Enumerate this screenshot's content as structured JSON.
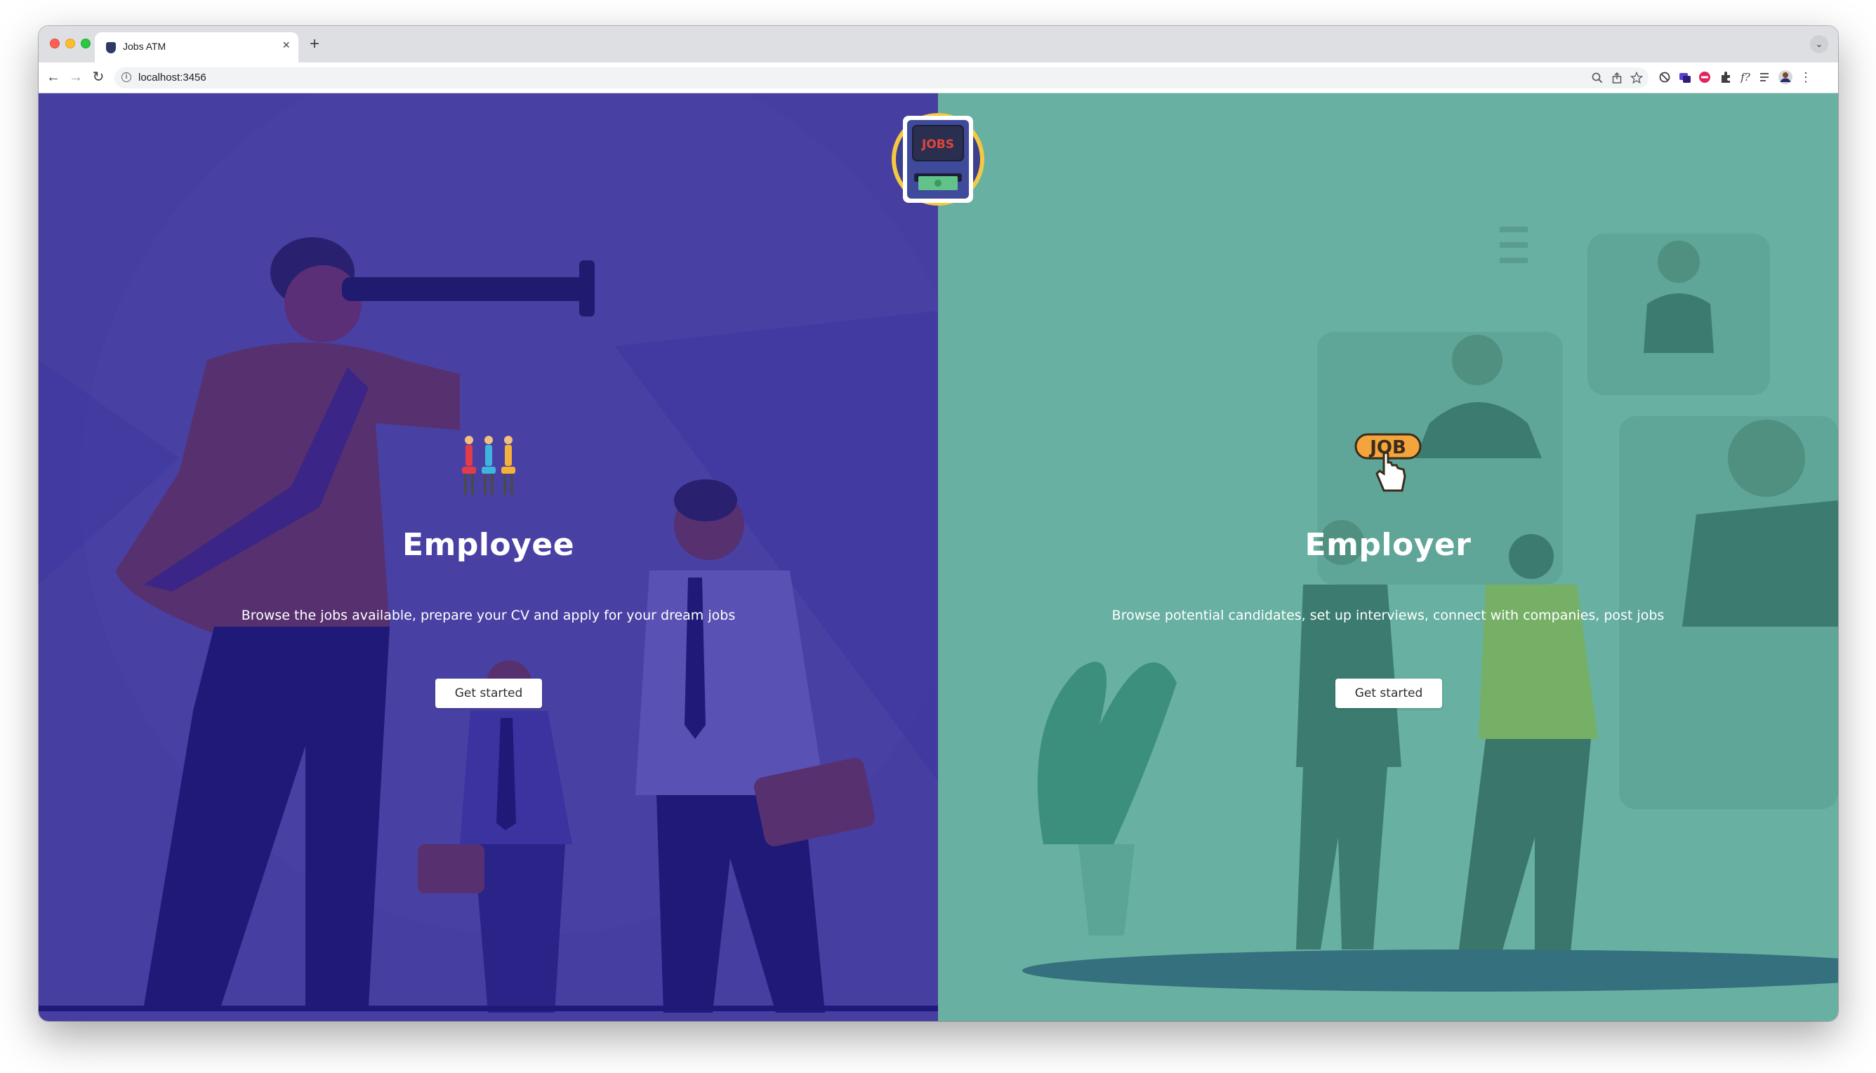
{
  "browser": {
    "tab_title": "Jobs ATM",
    "tab_close": "×",
    "new_tab": "+",
    "tab_menu": "⌄",
    "url": "localhost:3456",
    "back": "←",
    "forward": "→",
    "reload": "↻"
  },
  "logo": {
    "label": "JOBS"
  },
  "employee": {
    "title": "Employee",
    "description": "Browse the jobs available, prepare your CV and apply for your dream jobs",
    "button_label": "Get started"
  },
  "employer": {
    "title": "Employer",
    "description": "Browse potential candidates, set up interviews, connect with companies, post jobs",
    "button_label": "Get started",
    "icon_text": "JOB"
  },
  "colors": {
    "employee_bg": "#463ea0",
    "employer_bg": "#68b0a1",
    "button_bg": "#ffffff",
    "logo_ring": "#f5c842"
  }
}
